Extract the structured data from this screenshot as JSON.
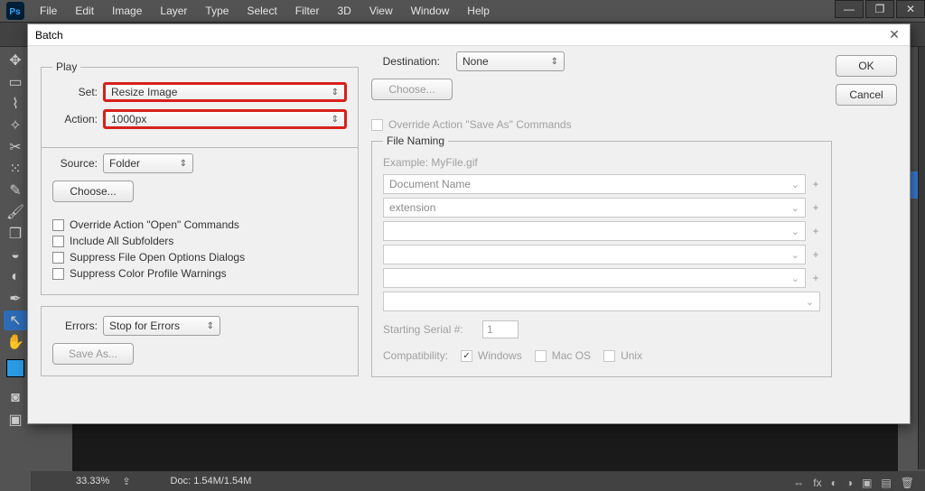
{
  "menubar": [
    "File",
    "Edit",
    "Image",
    "Layer",
    "Type",
    "Select",
    "Filter",
    "3D",
    "View",
    "Window",
    "Help"
  ],
  "dialog": {
    "title": "Batch",
    "play": {
      "legend": "Play",
      "set_label": "Set:",
      "set_value": "Resize Image",
      "action_label": "Action:",
      "action_value": "1000px"
    },
    "source": {
      "label": "Source:",
      "value": "Folder",
      "choose": "Choose...",
      "opts": [
        "Override Action \"Open\" Commands",
        "Include All Subfolders",
        "Suppress File Open Options Dialogs",
        "Suppress Color Profile Warnings"
      ]
    },
    "errors": {
      "label": "Errors:",
      "value": "Stop for Errors",
      "save_as": "Save As..."
    },
    "destination": {
      "label": "Destination:",
      "value": "None",
      "choose": "Choose...",
      "override": "Override Action \"Save As\" Commands"
    },
    "file_naming": {
      "legend": "File Naming",
      "example_label": "Example:",
      "example_value": "MyFile.gif",
      "fields": [
        "Document Name",
        "extension",
        "",
        "",
        "",
        ""
      ],
      "starting_label": "Starting Serial #:",
      "starting_value": "1",
      "compat_label": "Compatibility:",
      "compat": {
        "windows": "Windows",
        "mac": "Mac OS",
        "unix": "Unix"
      }
    },
    "buttons": {
      "ok": "OK",
      "cancel": "Cancel"
    }
  },
  "status": {
    "zoom": "33.33%",
    "doc": "Doc: 1.54M/1.54M"
  }
}
